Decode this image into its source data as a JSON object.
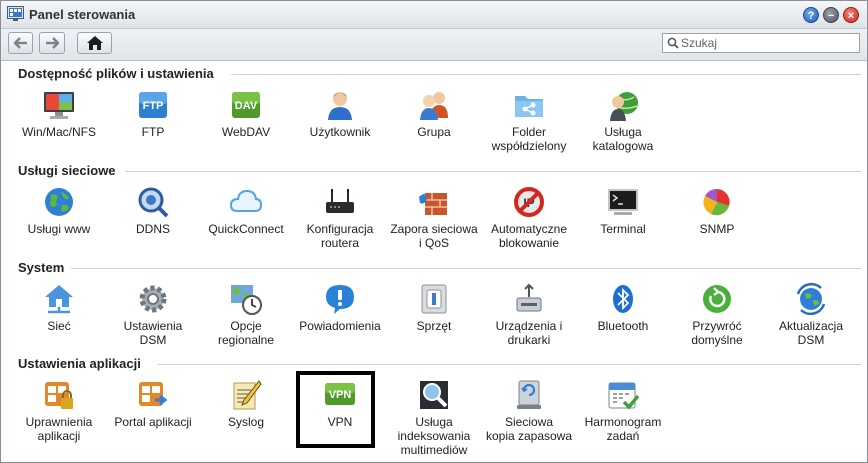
{
  "window": {
    "title": "Panel sterowania"
  },
  "toolbar": {
    "search_placeholder": "Szukaj"
  },
  "sections": [
    {
      "title": "Dostępność plików i ustawienia",
      "items": [
        {
          "label": "Win/Mac/NFS",
          "icon": "win-mac-nfs-icon"
        },
        {
          "label": "FTP",
          "icon": "ftp-icon"
        },
        {
          "label": "WebDAV",
          "icon": "webdav-icon"
        },
        {
          "label": "Użytkownik",
          "icon": "user-icon"
        },
        {
          "label": "Grupa",
          "icon": "group-icon"
        },
        {
          "label": "Folder\nwspółdzielony",
          "icon": "shared-folder-icon"
        },
        {
          "label": "Usługa\nkatalogowa",
          "icon": "directory-service-icon"
        }
      ]
    },
    {
      "title": "Usługi sieciowe",
      "items": [
        {
          "label": "Usługi www",
          "icon": "web-services-icon"
        },
        {
          "label": "DDNS",
          "icon": "ddns-icon"
        },
        {
          "label": "QuickConnect",
          "icon": "quickconnect-cloud-icon"
        },
        {
          "label": "Konfiguracja\nroutera",
          "icon": "router-icon"
        },
        {
          "label": "Zapora sieciowa\ni QoS",
          "icon": "firewall-icon"
        },
        {
          "label": "Automatyczne\nblokowanie",
          "icon": "auto-block-icon"
        },
        {
          "label": "Terminal",
          "icon": "terminal-icon"
        },
        {
          "label": "SNMP",
          "icon": "snmp-icon"
        }
      ]
    },
    {
      "title": "System",
      "items": [
        {
          "label": "Sieć",
          "icon": "network-icon"
        },
        {
          "label": "Ustawienia\nDSM",
          "icon": "dsm-settings-gear-icon"
        },
        {
          "label": "Opcje\nregionalne",
          "icon": "regional-options-icon"
        },
        {
          "label": "Powiadomienia",
          "icon": "notification-icon"
        },
        {
          "label": "Sprzęt",
          "icon": "hardware-icon"
        },
        {
          "label": "Urządzenia i\ndrukarki",
          "icon": "devices-printers-icon"
        },
        {
          "label": "Bluetooth",
          "icon": "bluetooth-icon"
        },
        {
          "label": "Przywróć\ndomyślne",
          "icon": "restore-defaults-icon"
        },
        {
          "label": "Aktualizacja\nDSM",
          "icon": "dsm-update-icon"
        }
      ]
    },
    {
      "title": "Ustawienia aplikacji",
      "items": [
        {
          "label": "Uprawnienia\naplikacji",
          "icon": "app-privileges-icon"
        },
        {
          "label": "Portal aplikacji",
          "icon": "app-portal-icon"
        },
        {
          "label": "Syslog",
          "icon": "syslog-icon"
        },
        {
          "label": "VPN",
          "icon": "vpn-icon"
        },
        {
          "label": "Usługa\nindeksowania\nmultimediów",
          "icon": "media-indexing-icon"
        },
        {
          "label": "Sieciowa\nkopia zapasowa",
          "icon": "network-backup-icon"
        },
        {
          "label": "Harmonogram\nzadań",
          "icon": "task-scheduler-icon"
        }
      ]
    }
  ],
  "icon_texts": {
    "ftp": "FTP",
    "webdav": "DAV",
    "vpn": "VPN"
  },
  "selected_item": "VPN",
  "colors": {
    "accent": "#1e5bbf",
    "selection_border": "#000000"
  }
}
